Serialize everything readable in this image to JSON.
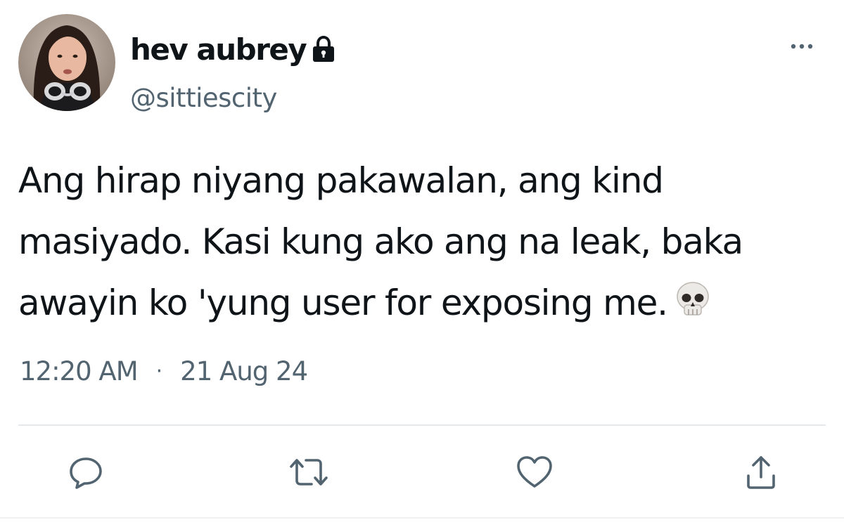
{
  "author": {
    "display_name": "hev aubrey",
    "handle": "@sittiescity",
    "protected_icon": "lock-icon",
    "avatar": "avatar-photo"
  },
  "tweet": {
    "lines": [
      "Ang hirap niyang pakawalan, ang kind",
      "masiyado. Kasi kung ako ang na leak, baka",
      "awayin ko 'yung user for exposing me."
    ],
    "emoji": "skull-emoji",
    "time": "12:20 AM",
    "separator": "·",
    "date": "21 Aug 24"
  },
  "actions": [
    {
      "name": "reply",
      "icon": "reply-icon"
    },
    {
      "name": "retweet",
      "icon": "retweet-icon"
    },
    {
      "name": "like",
      "icon": "heart-icon"
    },
    {
      "name": "share",
      "icon": "share-icon"
    }
  ],
  "more_icon": "more-options-icon",
  "colors": {
    "text": "#0f1419",
    "secondary": "#536471",
    "divider": "#e6e9eb",
    "background": "#ffffff"
  }
}
